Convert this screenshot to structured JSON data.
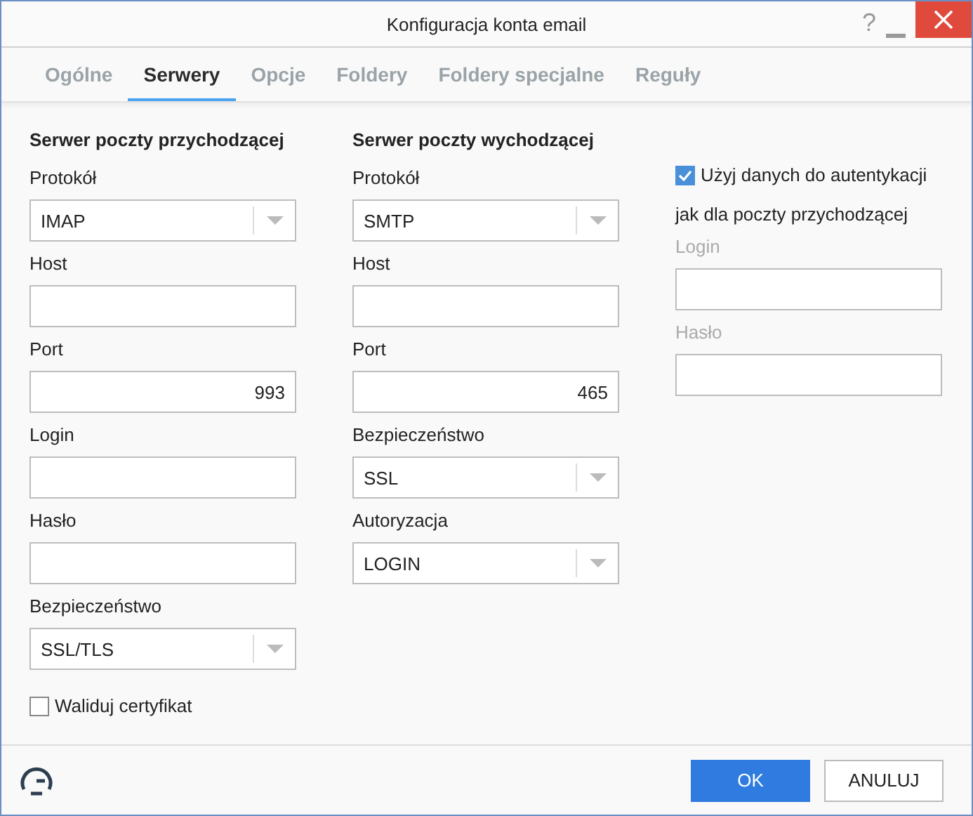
{
  "window": {
    "title": "Konfiguracja konta email",
    "help": "?"
  },
  "tabs": [
    {
      "label": "Ogólne",
      "selected": false
    },
    {
      "label": "Serwery",
      "selected": true
    },
    {
      "label": "Opcje",
      "selected": false
    },
    {
      "label": "Foldery",
      "selected": false
    },
    {
      "label": "Foldery specjalne",
      "selected": false
    },
    {
      "label": "Reguły",
      "selected": false
    }
  ],
  "incoming": {
    "heading": "Serwer poczty przychodzącej",
    "fields": [
      {
        "label": "Protokół",
        "kind": "select",
        "value": "IMAP"
      },
      {
        "label": "Host",
        "kind": "text"
      },
      {
        "label": "Port",
        "kind": "number",
        "value": "993"
      },
      {
        "label": "Login",
        "kind": "text"
      },
      {
        "label": "Hasło",
        "kind": "text"
      },
      {
        "label": "Bezpieczeństwo",
        "kind": "select",
        "value": "SSL/TLS"
      }
    ],
    "validate": {
      "label": "Waliduj certyfikat",
      "checked": false
    }
  },
  "outgoing": {
    "heading": "Serwer poczty wychodzącej",
    "fields": [
      {
        "label": "Protokół",
        "kind": "select",
        "value": "SMTP"
      },
      {
        "label": "Host",
        "kind": "text"
      },
      {
        "label": "Port",
        "kind": "number",
        "value": "465"
      },
      {
        "label": "Bezpieczeństwo",
        "kind": "select",
        "value": "SSL"
      },
      {
        "label": "Autoryzacja",
        "kind": "select",
        "value": "LOGIN"
      }
    ]
  },
  "auth": {
    "checkbox": {
      "label": "Użyj danych do autentykacji",
      "checked": true
    },
    "note": "jak dla poczty przychodzącej",
    "fields": [
      {
        "label": "Login",
        "kind": "text",
        "disabled": true
      },
      {
        "label": "Hasło",
        "kind": "text",
        "disabled": true
      }
    ]
  },
  "buttons": [
    {
      "label": "OK",
      "kind": "primary"
    },
    {
      "label": "ANULUJ",
      "kind": "secondary"
    }
  ]
}
